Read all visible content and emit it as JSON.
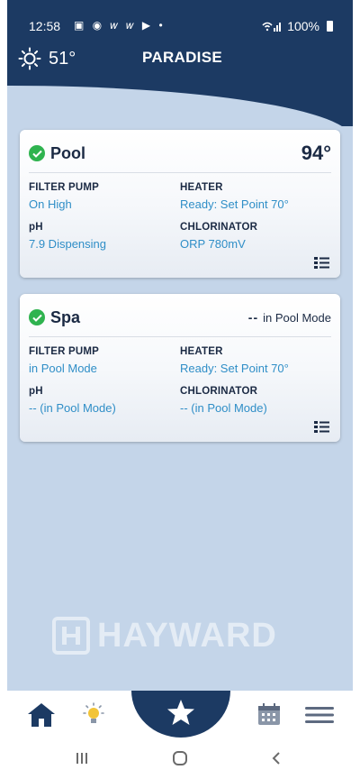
{
  "status_bar": {
    "time": "12:58",
    "notification_icons": "▣ ◉ 𝑤 𝑤 ▶ •",
    "battery": "100%"
  },
  "header": {
    "weather_temp": "51°",
    "site_name": "PARADISE"
  },
  "pool": {
    "name": "Pool",
    "temperature": "94°",
    "filter_pump_label": "FILTER PUMP",
    "filter_pump_value": "On High",
    "heater_label": "HEATER",
    "heater_value": "Ready: Set Point 70°",
    "ph_label": "pH",
    "ph_value": "7.9 Dispensing",
    "chlorinator_label": "CHLORINATOR",
    "chlorinator_value": "ORP 780mV"
  },
  "spa": {
    "name": "Spa",
    "temperature_dashes": "--",
    "mode_text": "in Pool Mode",
    "filter_pump_label": "FILTER PUMP",
    "filter_pump_value": "in Pool Mode",
    "heater_label": "HEATER",
    "heater_value": "Ready: Set Point 70°",
    "ph_label": "pH",
    "ph_value": "-- (in Pool Mode)",
    "chlorinator_label": "CHLORINATOR",
    "chlorinator_value": "-- (in Pool Mode)"
  },
  "brand": {
    "name": "HAYWARD"
  },
  "bottom_nav": {
    "items": [
      "home-icon",
      "lightbulb-icon",
      "star-icon",
      "calendar-icon",
      "menu-icon"
    ]
  },
  "colors": {
    "header_navy": "#1c3a63",
    "background_blue": "#c4d5e9",
    "value_blue": "#2f8ec7",
    "status_green": "#2fb34f"
  }
}
